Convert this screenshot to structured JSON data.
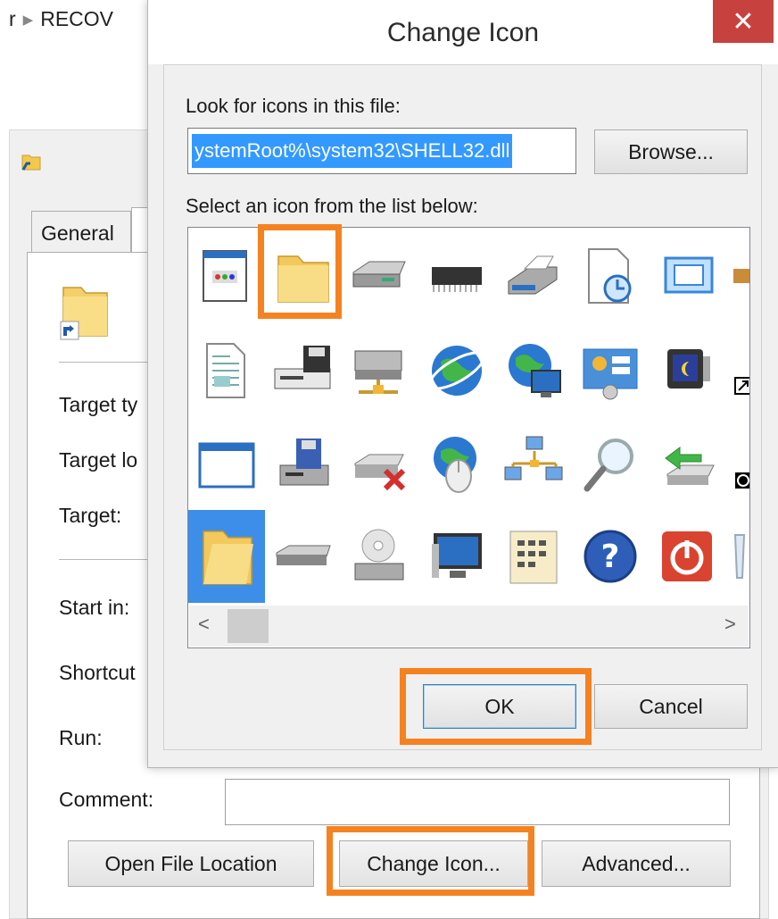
{
  "explorer": {
    "breadcrumb_prefix": "r",
    "breadcrumb_current": "RECOV"
  },
  "properties": {
    "tabs": {
      "general": "General"
    },
    "fields": {
      "target_type": "Target ty",
      "target_location": "Target lo",
      "target": "Target:",
      "start_in": "Start in:",
      "shortcut": "Shortcut",
      "run": "Run:",
      "comment": "Comment:"
    },
    "buttons": {
      "open_file_location": "Open File Location",
      "change_icon": "Change Icon...",
      "advanced": "Advanced..."
    }
  },
  "dialog": {
    "title": "Change Icon",
    "close_glyph": "✕",
    "look_label": "Look for icons in this file:",
    "file_path": "ystemRoot%\\system32\\SHELL32.dll",
    "browse": "Browse...",
    "select_label": "Select an icon from the list below:",
    "ok": "OK",
    "cancel": "Cancel",
    "scroll_left": "<",
    "scroll_right": ">",
    "icons": [
      "application-window-icon",
      "folder-icon",
      "hard-drive-icon",
      "memory-chip-icon",
      "printer-icon",
      "clock-document-icon",
      "display-properties-icon",
      "partial-icon",
      "text-document-icon",
      "computer-floppy-icon",
      "network-drive-icon",
      "globe-icon",
      "network-globe-icon",
      "control-panel-icon",
      "screensaver-icon",
      "shortcut-arrow-icon",
      "window-icon",
      "floppy-drive-icon",
      "disconnected-drive-icon",
      "globe-mouse-icon",
      "network-computers-icon",
      "magnifier-icon",
      "usb-drive-arrow-icon",
      "clock-small-icon",
      "open-folder-icon",
      "removable-drive-icon",
      "cd-drive-icon",
      "monitor-icon",
      "grid-document-icon",
      "help-icon",
      "power-icon",
      "recycle-bin-icon"
    ],
    "selected_index": 24,
    "highlighted_index": 1
  },
  "colors": {
    "highlight": "#f58220",
    "selection": "#3399ff",
    "close_button": "#c7423f"
  }
}
